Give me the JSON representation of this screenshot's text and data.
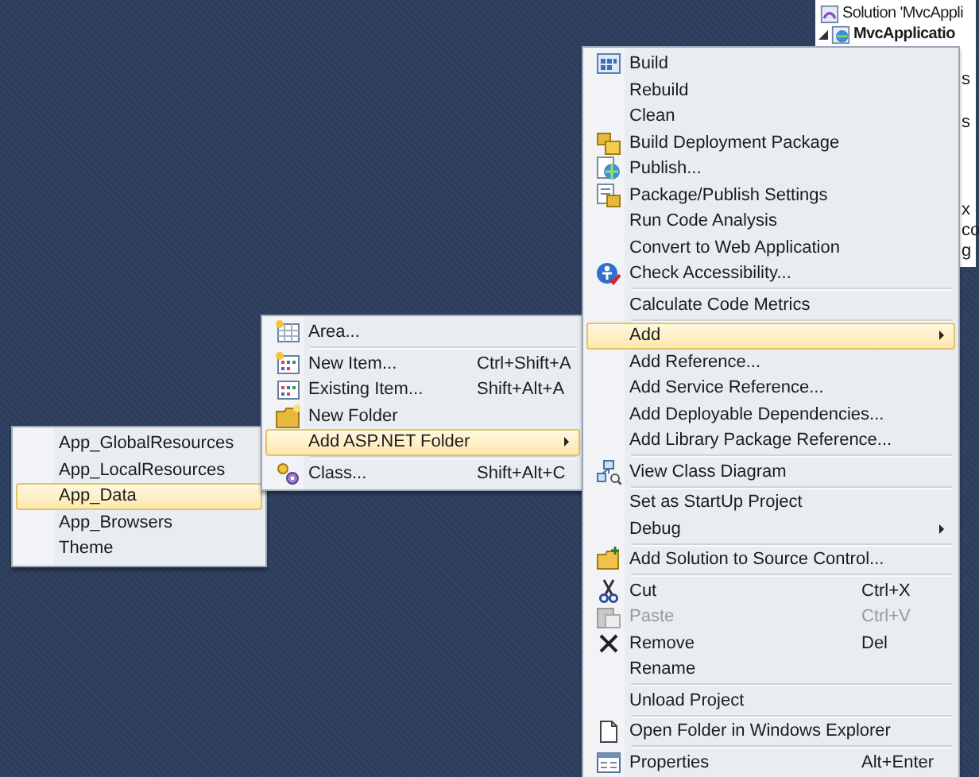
{
  "solution_explorer": {
    "rows": [
      {
        "label": "Solution 'MvcAppli",
        "bold": false
      },
      {
        "label": "MvcApplicatio",
        "bold": true
      }
    ],
    "fragments": [
      "s",
      "s",
      "x",
      "co",
      "g"
    ]
  },
  "menus": [
    {
      "items": [
        {
          "kind": "item",
          "label": "App_GlobalResources",
          "selected": false,
          "disabled": false
        },
        {
          "kind": "item",
          "label": "App_LocalResources",
          "selected": false,
          "disabled": false
        },
        {
          "kind": "item",
          "label": "App_Data",
          "selected": true,
          "disabled": false
        },
        {
          "kind": "item",
          "label": "App_Browsers",
          "selected": false,
          "disabled": false
        },
        {
          "kind": "item",
          "label": "Theme",
          "selected": false,
          "disabled": false
        }
      ]
    },
    {
      "items": [
        {
          "kind": "item",
          "label": "Area...",
          "selected": false,
          "disabled": false
        },
        {
          "kind": "separator"
        },
        {
          "kind": "item",
          "label": "New Item...",
          "shortcut": "Ctrl+Shift+A",
          "selected": false,
          "disabled": false
        },
        {
          "kind": "item",
          "label": "Existing Item...",
          "shortcut": "Shift+Alt+A",
          "selected": false,
          "disabled": false
        },
        {
          "kind": "item",
          "label": "New Folder",
          "selected": false,
          "disabled": false
        },
        {
          "kind": "item",
          "label": "Add ASP.NET Folder",
          "selected": true,
          "disabled": false,
          "submenu": true
        },
        {
          "kind": "separator"
        },
        {
          "kind": "item",
          "label": "Class...",
          "shortcut": "Shift+Alt+C",
          "selected": false,
          "disabled": false
        }
      ]
    },
    {
      "items": [
        {
          "kind": "item",
          "label": "Build",
          "selected": false,
          "disabled": false
        },
        {
          "kind": "item",
          "label": "Rebuild",
          "selected": false,
          "disabled": false
        },
        {
          "kind": "item",
          "label": "Clean",
          "selected": false,
          "disabled": false
        },
        {
          "kind": "item",
          "label": "Build Deployment Package",
          "selected": false,
          "disabled": false
        },
        {
          "kind": "item",
          "label": "Publish...",
          "selected": false,
          "disabled": false
        },
        {
          "kind": "item",
          "label": "Package/Publish Settings",
          "selected": false,
          "disabled": false
        },
        {
          "kind": "item",
          "label": "Run Code Analysis",
          "selected": false,
          "disabled": false
        },
        {
          "kind": "item",
          "label": "Convert to Web Application",
          "selected": false,
          "disabled": false
        },
        {
          "kind": "item",
          "label": "Check Accessibility...",
          "selected": false,
          "disabled": false
        },
        {
          "kind": "separator"
        },
        {
          "kind": "item",
          "label": "Calculate Code Metrics",
          "selected": false,
          "disabled": false
        },
        {
          "kind": "separator"
        },
        {
          "kind": "item",
          "label": "Add",
          "selected": true,
          "disabled": false,
          "submenu": true
        },
        {
          "kind": "item",
          "label": "Add Reference...",
          "selected": false,
          "disabled": false
        },
        {
          "kind": "item",
          "label": "Add Service Reference...",
          "selected": false,
          "disabled": false
        },
        {
          "kind": "item",
          "label": "Add Deployable Dependencies...",
          "selected": false,
          "disabled": false
        },
        {
          "kind": "item",
          "label": "Add Library Package Reference...",
          "selected": false,
          "disabled": false
        },
        {
          "kind": "separator"
        },
        {
          "kind": "item",
          "label": "View Class Diagram",
          "selected": false,
          "disabled": false
        },
        {
          "kind": "separator"
        },
        {
          "kind": "item",
          "label": "Set as StartUp Project",
          "selected": false,
          "disabled": false
        },
        {
          "kind": "item",
          "label": "Debug",
          "selected": false,
          "disabled": false,
          "submenu": true
        },
        {
          "kind": "separator"
        },
        {
          "kind": "item",
          "label": "Add Solution to Source Control...",
          "selected": false,
          "disabled": false
        },
        {
          "kind": "separator"
        },
        {
          "kind": "item",
          "label": "Cut",
          "shortcut": "Ctrl+X",
          "selected": false,
          "disabled": false
        },
        {
          "kind": "item",
          "label": "Paste",
          "shortcut": "Ctrl+V",
          "selected": false,
          "disabled": true
        },
        {
          "kind": "item",
          "label": "Remove",
          "shortcut": "Del",
          "selected": false,
          "disabled": false
        },
        {
          "kind": "item",
          "label": "Rename",
          "selected": false,
          "disabled": false
        },
        {
          "kind": "separator"
        },
        {
          "kind": "item",
          "label": "Unload Project",
          "selected": false,
          "disabled": false
        },
        {
          "kind": "separator"
        },
        {
          "kind": "item",
          "label": "Open Folder in Windows Explorer",
          "selected": false,
          "disabled": false
        },
        {
          "kind": "separator"
        },
        {
          "kind": "item",
          "label": "Properties",
          "shortcut": "Alt+Enter",
          "selected": false,
          "disabled": false
        }
      ]
    }
  ]
}
